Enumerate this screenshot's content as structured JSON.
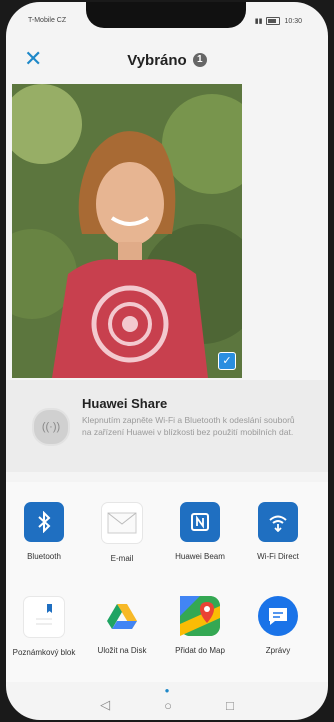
{
  "status_bar": {
    "carrier": "T-Mobile CZ",
    "time": "10:30"
  },
  "header": {
    "close_icon": "close-icon",
    "title": "Vybráno",
    "count": "1"
  },
  "photo": {
    "selected": true,
    "check_icon": "check-icon"
  },
  "huawei_share": {
    "title": "Huawei Share",
    "description": "Klepnutím zapněte Wi-Fi a Bluetooth k odeslání souborů na zařízení Huawei v blízkosti bez použití mobilních dat."
  },
  "apps": [
    {
      "label": "Bluetooth",
      "icon": "bluetooth-icon"
    },
    {
      "label": "E-mail",
      "icon": "email-icon"
    },
    {
      "label": "Huawei Beam",
      "icon": "nfc-icon"
    },
    {
      "label": "Wi-Fi Direct",
      "icon": "wifi-direct-icon"
    },
    {
      "label": "Poznámkový blok",
      "icon": "notepad-icon"
    },
    {
      "label": "Uložit na Disk",
      "icon": "google-drive-icon"
    },
    {
      "label": "Přidat do Map",
      "icon": "google-maps-icon"
    },
    {
      "label": "Zprávy",
      "icon": "messages-icon"
    }
  ],
  "colors": {
    "accent": "#1e88c8",
    "app_blue": "#1f6fc1"
  }
}
